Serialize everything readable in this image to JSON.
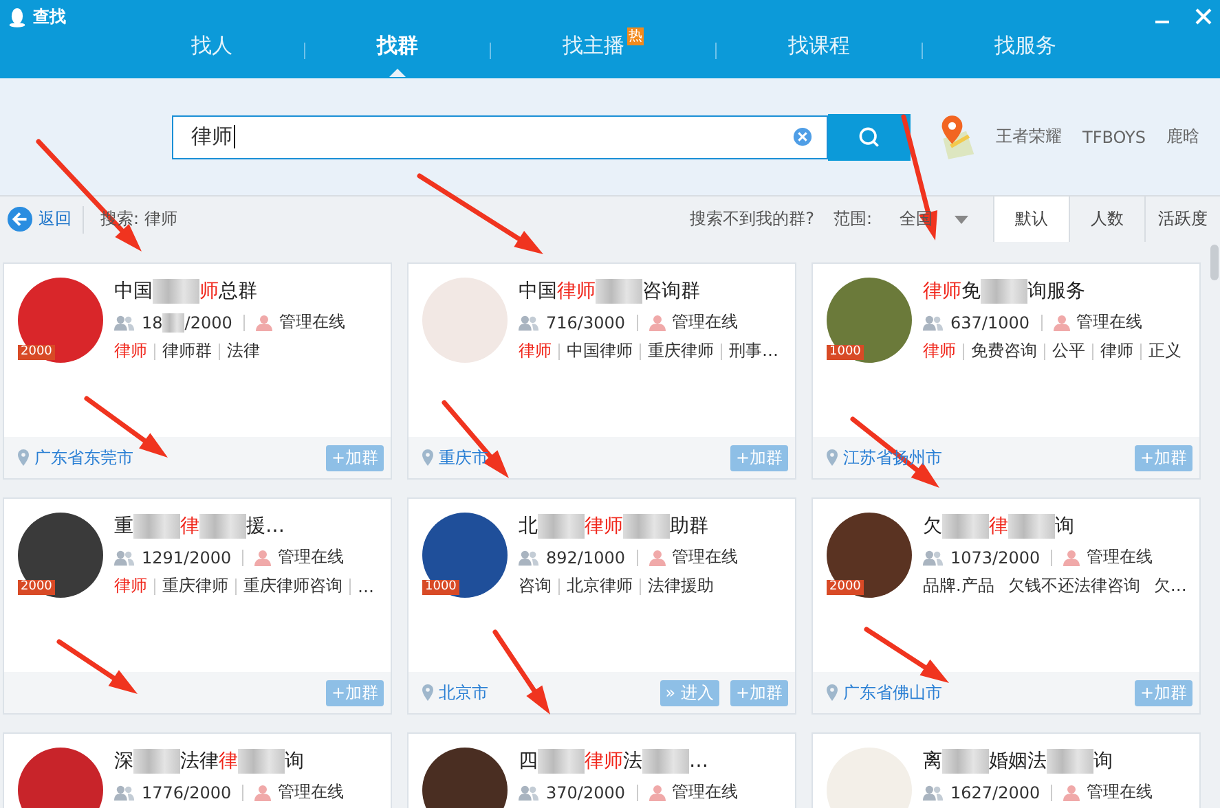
{
  "window": {
    "title": "查找"
  },
  "nav_tabs": [
    {
      "label": "找人",
      "selected": false
    },
    {
      "label": "找群",
      "selected": true
    },
    {
      "label": "找主播",
      "selected": false,
      "badge": "热"
    },
    {
      "label": "找课程",
      "selected": false
    },
    {
      "label": "找服务",
      "selected": false
    }
  ],
  "search": {
    "value": "律师"
  },
  "hot_keywords": [
    "王者荣耀",
    "TFBOYS",
    "鹿晗"
  ],
  "filter_bar": {
    "back": "返回",
    "query": "搜索: 律师",
    "help_link": "搜索不到我的群?",
    "scope_label": "范围:",
    "scope_value": "全国"
  },
  "sort_tabs": [
    {
      "label": "默认",
      "selected": true
    },
    {
      "label": "人数",
      "selected": false
    },
    {
      "label": "活跃度",
      "selected": false
    }
  ],
  "groups": [
    {
      "title": [
        {
          "kind": "text",
          "text": "中国"
        },
        {
          "kind": "blur"
        },
        {
          "kind": "red",
          "text": "师"
        },
        {
          "kind": "text",
          "text": "总群"
        }
      ],
      "members": [
        {
          "kind": "text",
          "text": "18"
        },
        {
          "kind": "blur"
        },
        {
          "kind": "text",
          "text": "/2000"
        }
      ],
      "admin": "管理在线",
      "badge": "2000",
      "tags": [
        {
          "text": "律师",
          "highlight": true
        },
        {
          "text": "律师群",
          "highlight": false
        },
        {
          "text": "法律",
          "highlight": false
        }
      ],
      "location": "广东省东莞市",
      "buttons": [
        "+加群"
      ]
    },
    {
      "title": [
        {
          "kind": "text",
          "text": "中国"
        },
        {
          "kind": "red",
          "text": "律师"
        },
        {
          "kind": "blur"
        },
        {
          "kind": "text",
          "text": "咨询群"
        }
      ],
      "members": [
        {
          "kind": "text",
          "text": "716/3000"
        }
      ],
      "admin": "管理在线",
      "tags": [
        {
          "text": "律师",
          "highlight": true
        },
        {
          "text": "中国律师",
          "highlight": false
        },
        {
          "text": "重庆律师",
          "highlight": false
        },
        {
          "text": "刑事…",
          "highlight": false
        }
      ],
      "location": "重庆市",
      "buttons": [
        "+加群"
      ]
    },
    {
      "title": [
        {
          "kind": "red",
          "text": "律师"
        },
        {
          "kind": "text",
          "text": "免"
        },
        {
          "kind": "blur"
        },
        {
          "kind": "text",
          "text": "询服务"
        }
      ],
      "members": [
        {
          "kind": "text",
          "text": "637/1000"
        }
      ],
      "admin": "管理在线",
      "badge": "1000",
      "tags": [
        {
          "text": "律师",
          "highlight": true
        },
        {
          "text": "免费咨询",
          "highlight": false
        },
        {
          "text": "公平",
          "highlight": false
        },
        {
          "text": "律师",
          "highlight": false
        },
        {
          "text": "正义",
          "highlight": false
        }
      ],
      "location": "江苏省扬州市",
      "buttons": [
        "+加群"
      ]
    },
    {
      "title": [
        {
          "kind": "text",
          "text": "重"
        },
        {
          "kind": "blur"
        },
        {
          "kind": "red",
          "text": "律"
        },
        {
          "kind": "blur"
        },
        {
          "kind": "text",
          "text": "援…"
        }
      ],
      "members": [
        {
          "kind": "text",
          "text": "1291/2000"
        }
      ],
      "admin": "管理在线",
      "badge": "2000",
      "tags": [
        {
          "text": "律师",
          "highlight": true
        },
        {
          "text": "重庆律师",
          "highlight": false
        },
        {
          "text": "重庆律师咨询",
          "highlight": false
        },
        {
          "text": "…",
          "highlight": false
        }
      ],
      "buttons": [
        "+加群"
      ]
    },
    {
      "title": [
        {
          "kind": "text",
          "text": "北"
        },
        {
          "kind": "blur"
        },
        {
          "kind": "red",
          "text": "律师"
        },
        {
          "kind": "blur"
        },
        {
          "kind": "text",
          "text": "助群"
        }
      ],
      "members": [
        {
          "kind": "text",
          "text": "892/1000"
        }
      ],
      "admin": "管理在线",
      "badge": "1000",
      "tags": [
        {
          "text": "咨询",
          "highlight": false
        },
        {
          "text": "北京律师",
          "highlight": false
        },
        {
          "text": "法律援助",
          "highlight": false
        }
      ],
      "location": "北京市",
      "buttons": [
        "» 进入",
        "+加群"
      ]
    },
    {
      "title": [
        {
          "kind": "text",
          "text": "欠"
        },
        {
          "kind": "blur"
        },
        {
          "kind": "red",
          "text": "律"
        },
        {
          "kind": "blur"
        },
        {
          "kind": "text",
          "text": "询"
        }
      ],
      "members": [
        {
          "kind": "text",
          "text": "1073/2000"
        }
      ],
      "admin": "管理在线",
      "badge": "2000",
      "tags": [
        {
          "text": "品牌.产品",
          "highlight": false
        },
        {
          "text": "欠钱不还法律咨询",
          "highlight": false
        },
        {
          "text": "欠…",
          "highlight": false
        }
      ],
      "location": "广东省佛山市",
      "buttons": [
        "+加群"
      ]
    },
    {
      "title": [
        {
          "kind": "text",
          "text": "深"
        },
        {
          "kind": "blur"
        },
        {
          "kind": "text",
          "text": "法律"
        },
        {
          "kind": "red",
          "text": "律"
        },
        {
          "kind": "blur"
        },
        {
          "kind": "text",
          "text": "询"
        }
      ],
      "members": [
        {
          "kind": "text",
          "text": "1776/2000"
        }
      ],
      "admin": "管理在线"
    },
    {
      "title": [
        {
          "kind": "text",
          "text": "四"
        },
        {
          "kind": "blur"
        },
        {
          "kind": "red",
          "text": "律师"
        },
        {
          "kind": "text",
          "text": "法"
        },
        {
          "kind": "blur"
        },
        {
          "kind": "text",
          "text": "…"
        }
      ],
      "members": [
        {
          "kind": "text",
          "text": "370/2000"
        }
      ],
      "admin": "管理在线"
    },
    {
      "title": [
        {
          "kind": "text",
          "text": "离"
        },
        {
          "kind": "blur"
        },
        {
          "kind": "text",
          "text": "婚姻法"
        },
        {
          "kind": "blur"
        },
        {
          "kind": "text",
          "text": "询"
        }
      ],
      "members": [
        {
          "kind": "text",
          "text": "1627/2000"
        }
      ],
      "admin": "管理在线"
    }
  ]
}
